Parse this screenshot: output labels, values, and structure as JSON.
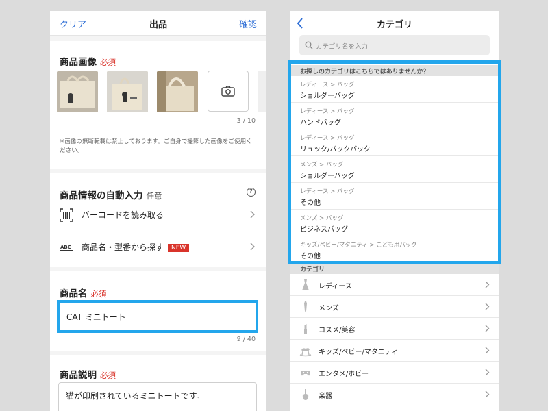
{
  "listing": {
    "nav": {
      "left": "クリア",
      "title": "出品",
      "right": "確認"
    },
    "photos": {
      "title": "商品画像",
      "required": "必須",
      "counter": "3 / 10",
      "note": "※画像の無断転載は禁止しております。ご自身で撮影した画像をご使用ください。"
    },
    "autofill": {
      "title": "商品情報の自動入力",
      "optional": "任意",
      "help": "?",
      "barcode": "バーコードを読み取る",
      "search": "商品名・型番から探す",
      "badge": "NEW"
    },
    "product_name": {
      "title": "商品名",
      "required": "必須",
      "value": "CAT ミニトート",
      "counter": "9 / 40"
    },
    "description": {
      "title": "商品説明",
      "required": "必須",
      "value": "猫が印刷されているミニトートです。"
    }
  },
  "category": {
    "title": "カテゴリ",
    "search_placeholder": "カテゴリ名を入力",
    "suggest_header": "お探しのカテゴリはこちらではありませんか？",
    "suggestions": [
      {
        "path": "レディース > バッグ",
        "name": "ショルダーバッグ"
      },
      {
        "path": "レディース > バッグ",
        "name": "ハンドバッグ"
      },
      {
        "path": "レディース > バッグ",
        "name": "リュック/バックパック"
      },
      {
        "path": "メンズ > バッグ",
        "name": "ショルダーバッグ"
      },
      {
        "path": "レディース > バッグ",
        "name": "その他"
      },
      {
        "path": "メンズ > バッグ",
        "name": "ビジネスバッグ"
      },
      {
        "path": "キッズ/ベビー/マタニティ > こども用バッグ",
        "name": "その他"
      }
    ],
    "list_header": "カテゴリ",
    "items": [
      {
        "label": "レディース",
        "icon": "dress-icon"
      },
      {
        "label": "メンズ",
        "icon": "necktie-icon"
      },
      {
        "label": "コスメ/美容",
        "icon": "lipstick-icon"
      },
      {
        "label": "キッズ/ベビー/マタニティ",
        "icon": "rocking-horse-icon"
      },
      {
        "label": "エンタメ/ホビー",
        "icon": "gamepad-icon"
      },
      {
        "label": "楽器",
        "icon": "instrument-icon"
      }
    ]
  },
  "colors": {
    "accent_blue": "#2f6fd6",
    "required_red": "#d9342b",
    "highlight": "#23a6ec"
  }
}
